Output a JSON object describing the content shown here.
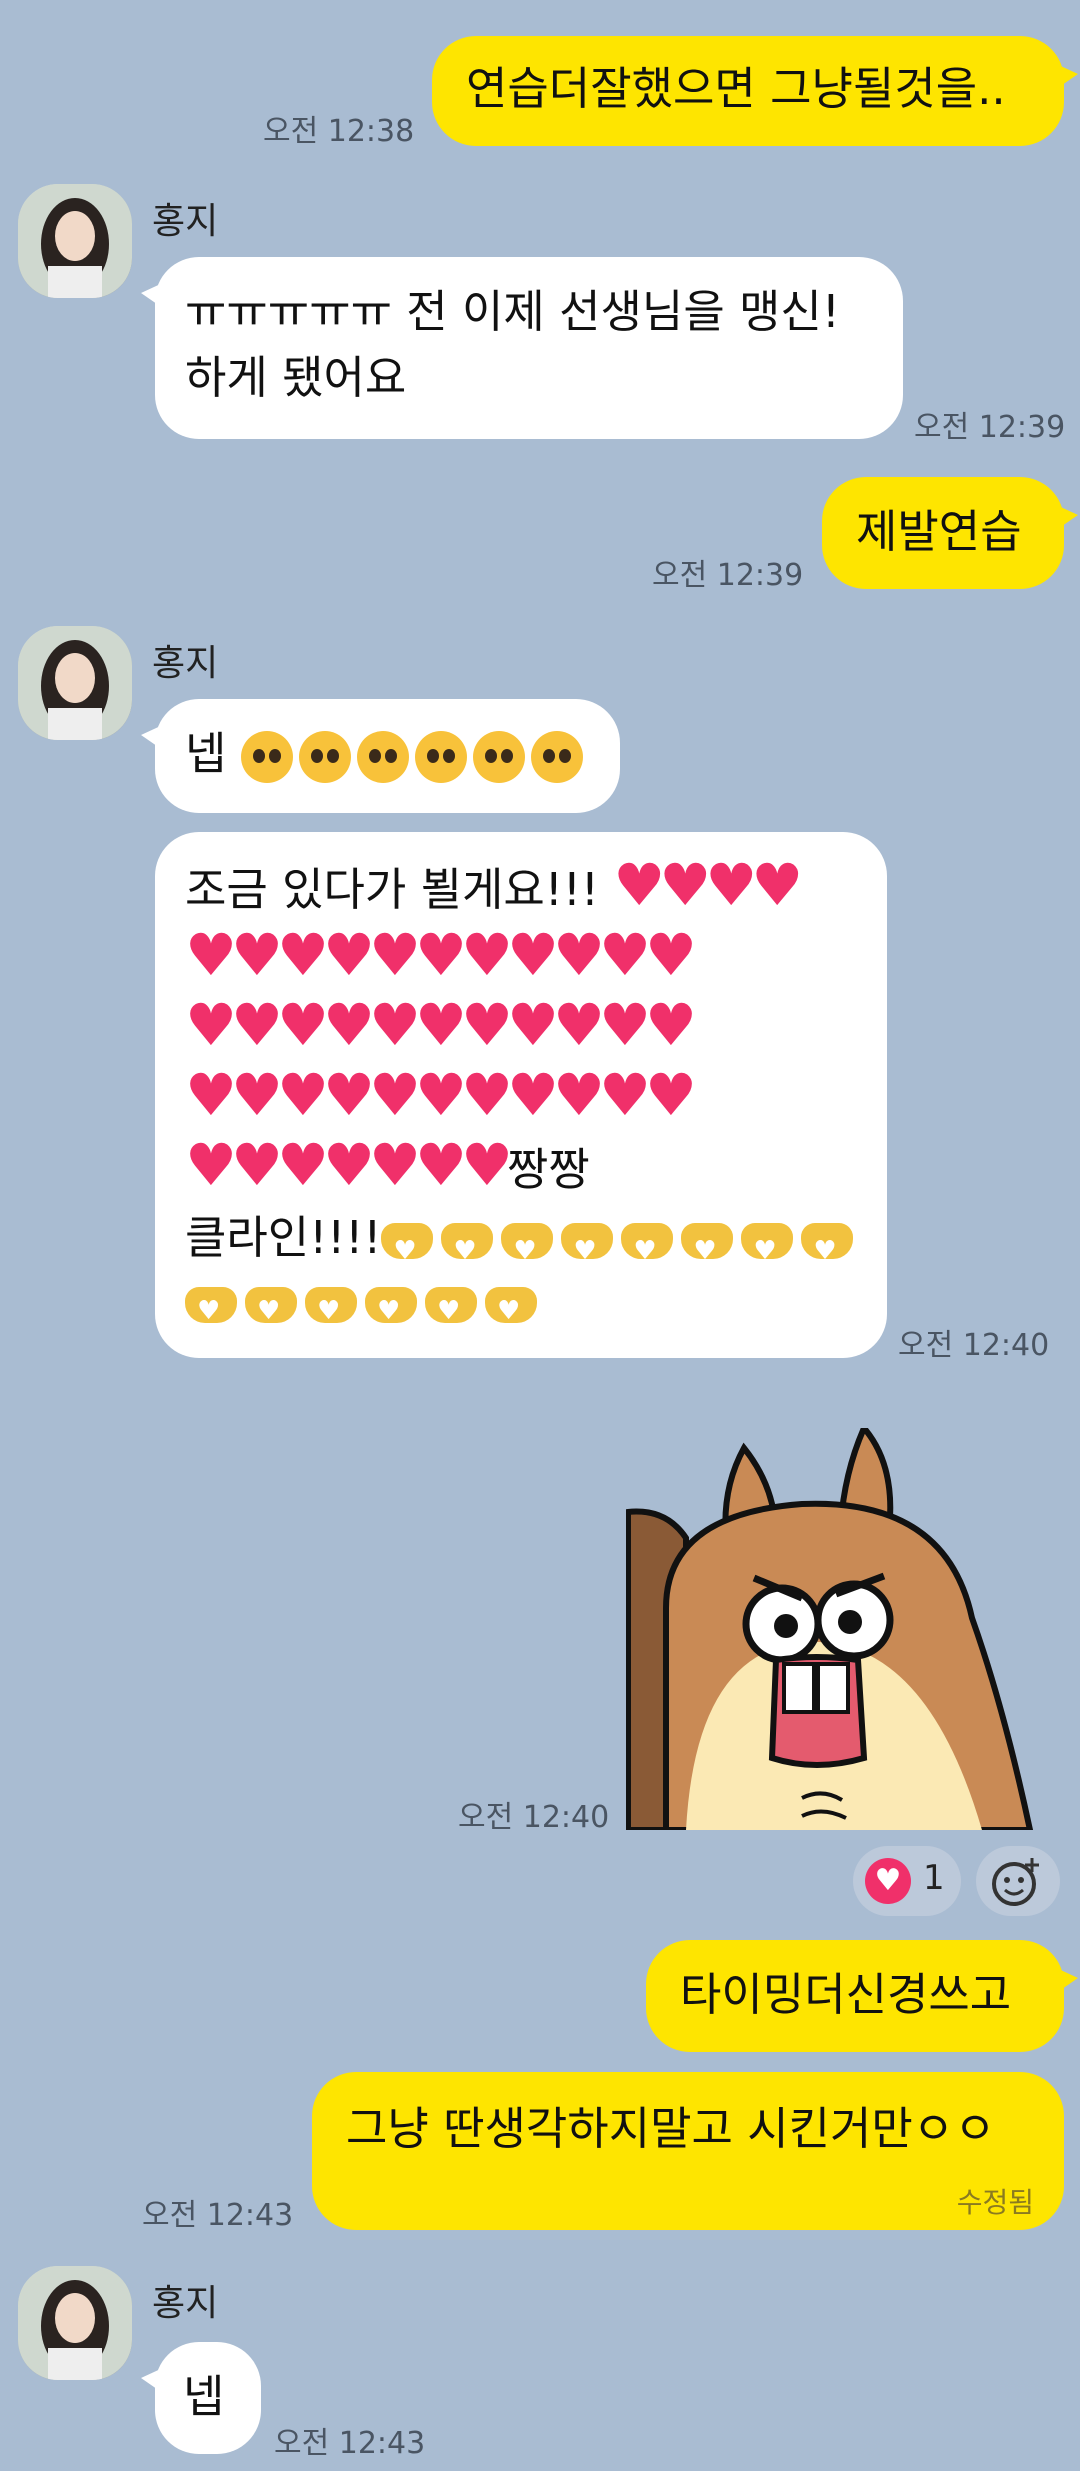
{
  "messages": [
    {
      "side": "me",
      "text": "연습더잘했으면 그냥될것을..",
      "time": "오전 12:38"
    },
    {
      "side": "you",
      "name": "홍지",
      "lines": [
        "ㅠㅠㅠㅠㅠ 전 이제 선생님을 맹신!",
        "하게 됐어요"
      ],
      "time": "오전 12:39"
    },
    {
      "side": "me",
      "text": "제발연습",
      "time": "오전 12:39"
    },
    {
      "side": "you",
      "name": "홍지",
      "text": "넵",
      "emoji_faces": 6
    },
    {
      "side": "you",
      "line1": "조금 있다가 뵐게요!!!",
      "line5_text": "짱짱",
      "line6_text": "클라인!!!!",
      "heart_rows": [
        4,
        11,
        11,
        11,
        7
      ],
      "hands_rows": [
        8,
        6
      ],
      "time": "오전 12:40"
    },
    {
      "side": "me",
      "type": "sticker",
      "sticker": "angry-squirrel",
      "time": "오전 12:40"
    },
    {
      "side": "me",
      "text": "타이밍더신경쓰고"
    },
    {
      "side": "me",
      "text": "그냥 딴생각하지말고 시킨거만ㅇㅇ",
      "edited": "수정됨",
      "time": "오전 12:43"
    },
    {
      "side": "you",
      "name": "홍지",
      "text": "넵",
      "time": "오전 12:43"
    }
  ],
  "reaction": {
    "icon": "heart-icon",
    "count": "1"
  },
  "colors": {
    "background": "#a9bcd2",
    "my_bubble": "#fee500",
    "their_bubble": "#ffffff"
  }
}
